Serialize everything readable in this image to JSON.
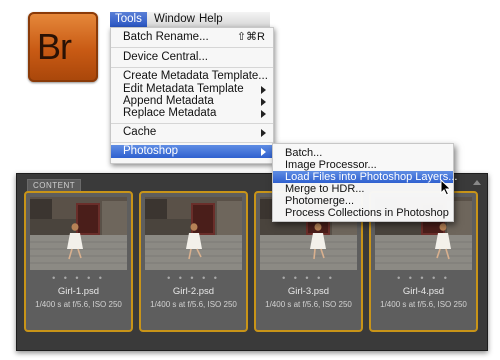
{
  "app_icon": {
    "text": "Br"
  },
  "menubar": {
    "items": [
      "Tools",
      "Window",
      "Help"
    ],
    "active": "Tools"
  },
  "tools_menu": {
    "batch_rename": {
      "label": "Batch Rename...",
      "shortcut": "⇧⌘R"
    },
    "device_central": "Device Central...",
    "create_metadata_template": "Create Metadata Template...",
    "edit_metadata_template": "Edit Metadata Template",
    "append_metadata": "Append Metadata",
    "replace_metadata": "Replace Metadata",
    "cache": "Cache",
    "photoshop": "Photoshop"
  },
  "photoshop_submenu": [
    "Batch...",
    "Image Processor...",
    "Load Files into Photoshop Layers...",
    "Merge to HDR...",
    "Photomerge...",
    "Process Collections in Photoshop"
  ],
  "content_panel": {
    "tab_label": "CONTENT",
    "thumbnails": [
      {
        "name": "Girl-1.psd",
        "meta": "1/400 s at f/5.6, ISO 250",
        "dots": "• • • • •"
      },
      {
        "name": "Girl-2.psd",
        "meta": "1/400 s at f/5.6, ISO 250",
        "dots": "• • • • •"
      },
      {
        "name": "Girl-3.psd",
        "meta": "1/400 s at f/5.6, ISO 250",
        "dots": "• • • • •"
      },
      {
        "name": "Girl-4.psd",
        "meta": "1/400 s at f/5.6, ISO 250",
        "dots": "• • • • •"
      }
    ]
  },
  "colors": {
    "highlight": "#2f60cf",
    "selection_border": "#c89418",
    "icon_orange": "#c85a14"
  }
}
